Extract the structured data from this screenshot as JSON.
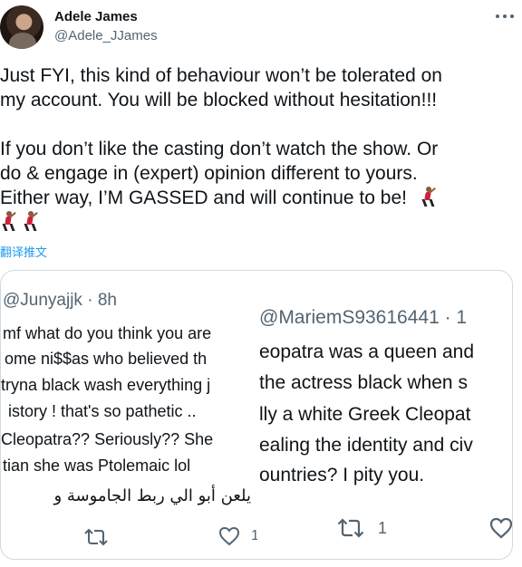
{
  "author": {
    "name": "Adele James",
    "handle": "@Adele_JJames"
  },
  "tweet": {
    "line1": "Just FYI, this kind of behaviour won’t be tolerated on",
    "line2": "my account. You will be blocked without hesitation!!!",
    "line3": "If you don’t like the casting don’t watch the show. Or",
    "line4": "do & engage in (expert) opinion different to yours.",
    "line5": "Either way, I’M GASSED and will continue to be!",
    "emojis": [
      "man-dancing-icon",
      "man-dancing-icon",
      "man-dancing-icon"
    ]
  },
  "translate_label": "翻译推文",
  "quote_left": {
    "handle": "@Junyajjk · 8h",
    "lines": [
      "mf what do you think you are",
      "ome ni$$as who believed th",
      "tryna black wash everything j",
      "istory ! that's so pathetic ..",
      "Cleopatra?? Seriously?? She",
      "tian she was Ptolemaic lol",
      "يلعن أبو الي ربط الجاموسة و"
    ],
    "like_count": "1"
  },
  "quote_right": {
    "handle": "@MariemS93616441 · 1",
    "lines": [
      "eopatra was a queen and",
      "the actress black when s",
      "lly a white Greek Cleopat",
      "ealing the identity and civ",
      "ountries? I pity you."
    ],
    "retweet_count": "1"
  },
  "colors": {
    "text": "#0f1419",
    "secondary": "#536471",
    "link": "#1d9bf0",
    "border": "#cfd9de"
  }
}
